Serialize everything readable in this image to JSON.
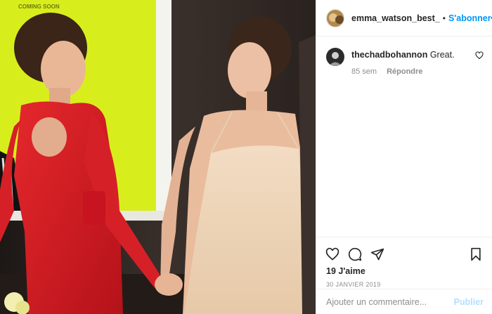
{
  "post": {
    "photo_banner_text": "COMING SOON",
    "author": {
      "username": "emma_watson_best_",
      "separator": "•",
      "follow_label": "S'abonner",
      "more_icon": "more-horizontal-icon"
    },
    "comments": [
      {
        "username": "thechadbohannon",
        "text": "Great.",
        "age": "85 sem",
        "reply_label": "Répondre",
        "like_icon": "heart-outline-icon"
      }
    ],
    "actions": {
      "like_icon": "heart-outline-icon",
      "comment_icon": "comment-bubble-icon",
      "share_icon": "paper-plane-icon",
      "save_icon": "bookmark-icon"
    },
    "likes": "19 J'aime",
    "date": "30 JANVIER 2019",
    "add_comment": {
      "placeholder": "Ajouter un commentaire...",
      "publish_label": "Publier"
    }
  },
  "colors": {
    "follow": "#0095f6",
    "publish_disabled": "#b2dffc",
    "muted": "#8e8e8e",
    "text": "#262626",
    "divider": "#efefef"
  }
}
